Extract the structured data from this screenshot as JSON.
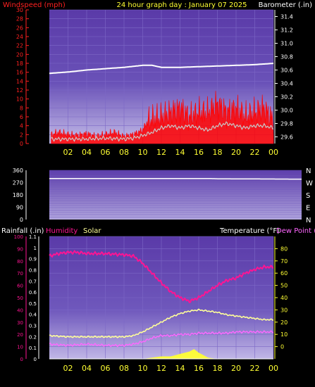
{
  "header": {
    "left_title": "Windspeed (mph)",
    "center_title": "24 hour graph day : January 07 2025",
    "right_title": "Barometer (.in)"
  },
  "mid_labels": {
    "rainfall": "Rainfall (.in)",
    "humidity": "Humidity",
    "solar": "Solar",
    "temperature": "Temperature (°F)",
    "dewpoint": "Dew Point ("
  },
  "colors": {
    "panel_top": "#5a3aa8",
    "panel_bottom": "#bdb4e6",
    "axis_red": "#ff2020",
    "axis_yellow": "#ffff33",
    "axis_white": "#ffffff",
    "wind": "#ff0000",
    "wind_avg": "#c8c8c8",
    "baro": "#ffffff",
    "humidity": "#ff1493",
    "solar": "#ffff33",
    "temperature": "#ffff99",
    "dewpoint": "#ff66ff",
    "rain": "#ffffff"
  },
  "chart_data": [
    {
      "type": "line",
      "name": "wind-barometer",
      "x_ticks": [
        "02",
        "04",
        "06",
        "08",
        "10",
        "12",
        "14",
        "16",
        "18",
        "20",
        "22",
        "00"
      ],
      "left_axis": {
        "title": "Windspeed (mph)",
        "ticks": [
          0,
          2,
          4,
          6,
          8,
          10,
          12,
          14,
          16,
          18,
          20,
          22,
          24,
          26,
          28,
          30
        ],
        "range": [
          0,
          30
        ]
      },
      "right_axis": {
        "title": "Barometer (.in)",
        "ticks": [
          29.6,
          29.8,
          30,
          30.2,
          30.4,
          30.6,
          30.8,
          31,
          31.2,
          31.4
        ],
        "range": [
          29.5,
          31.5
        ]
      },
      "series": [
        {
          "role": "wind-gust",
          "axis": "left",
          "points": [
            [
              0.2,
              2
            ],
            [
              1,
              2.5
            ],
            [
              2,
              2
            ],
            [
              3,
              1.8
            ],
            [
              4,
              2.2
            ],
            [
              5,
              1.6
            ],
            [
              6,
              2
            ],
            [
              7,
              2.5
            ],
            [
              8,
              1.5
            ],
            [
              9,
              2
            ],
            [
              10,
              3
            ],
            [
              10.5,
              5
            ],
            [
              11,
              5.5
            ],
            [
              12,
              6
            ],
            [
              13,
              7
            ],
            [
              14,
              8
            ],
            [
              15,
              6
            ],
            [
              16,
              7
            ],
            [
              17,
              7
            ],
            [
              18,
              9
            ],
            [
              19,
              7
            ],
            [
              20,
              8
            ],
            [
              21,
              6
            ],
            [
              22,
              7
            ],
            [
              23,
              8
            ],
            [
              24,
              5
            ]
          ]
        },
        {
          "role": "wind-average",
          "axis": "left",
          "points": [
            [
              0.2,
              1
            ],
            [
              2,
              1
            ],
            [
              4,
              1
            ],
            [
              6,
              1.2
            ],
            [
              8,
              1
            ],
            [
              9,
              1.2
            ],
            [
              10,
              1.8
            ],
            [
              11,
              2.5
            ],
            [
              12,
              3.5
            ],
            [
              13,
              4
            ],
            [
              14,
              3.5
            ],
            [
              15,
              4
            ],
            [
              16,
              3.5
            ],
            [
              17,
              3
            ],
            [
              18,
              4
            ],
            [
              19,
              4.5
            ],
            [
              20,
              4
            ],
            [
              21,
              3.5
            ],
            [
              22,
              4
            ],
            [
              23,
              4
            ],
            [
              24,
              3.5
            ]
          ]
        },
        {
          "role": "barometer",
          "axis": "right",
          "points": [
            [
              0,
              30.55
            ],
            [
              2,
              30.57
            ],
            [
              4,
              30.6
            ],
            [
              6,
              30.62
            ],
            [
              8,
              30.64
            ],
            [
              10,
              30.67
            ],
            [
              11,
              30.67
            ],
            [
              12,
              30.64
            ],
            [
              14,
              30.64
            ],
            [
              16,
              30.65
            ],
            [
              18,
              30.66
            ],
            [
              20,
              30.67
            ],
            [
              22,
              30.68
            ],
            [
              24,
              30.7
            ]
          ]
        }
      ]
    },
    {
      "type": "line",
      "name": "wind-direction",
      "right_labels": [
        "N",
        "W",
        "S",
        "E",
        "N"
      ],
      "left_axis": {
        "ticks": [
          0,
          90,
          180,
          270,
          360
        ],
        "range": [
          0,
          360
        ]
      },
      "series": [
        {
          "role": "direction",
          "points": [
            [
              0,
              300
            ],
            [
              15,
              300
            ],
            [
              16,
              298
            ],
            [
              24,
              295
            ]
          ]
        }
      ]
    },
    {
      "type": "line",
      "name": "rain-humidity-temperature",
      "x_ticks": [
        "02",
        "04",
        "06",
        "08",
        "10",
        "12",
        "14",
        "16",
        "18",
        "20",
        "22",
        "00"
      ],
      "left_axis": {
        "title": "Rainfall (.in)",
        "ticks": [
          0,
          10,
          20,
          30,
          40,
          50,
          60,
          70,
          80,
          90,
          100
        ],
        "range": [
          0,
          100
        ]
      },
      "left_inner_axis": {
        "ticks": [
          0,
          0.1,
          0.2,
          0.3,
          0.4,
          0.5,
          0.6,
          0.7,
          0.8,
          0.9,
          1,
          1.1
        ],
        "range": [
          0,
          1.1
        ]
      },
      "right_axis": {
        "title": "Temperature (°F)",
        "ticks": [
          0,
          10,
          20,
          30,
          40,
          50,
          60,
          70,
          80
        ],
        "range": [
          -10,
          90
        ]
      },
      "series": [
        {
          "role": "humidity",
          "axis": "percent",
          "points": [
            [
              0,
              84
            ],
            [
              1,
              86
            ],
            [
              2,
              87
            ],
            [
              3,
              87
            ],
            [
              4,
              86
            ],
            [
              6,
              86
            ],
            [
              8,
              85
            ],
            [
              9,
              84
            ],
            [
              10,
              78
            ],
            [
              11,
              70
            ],
            [
              12,
              62
            ],
            [
              13,
              55
            ],
            [
              14,
              50
            ],
            [
              15,
              47
            ],
            [
              16,
              50
            ],
            [
              17,
              55
            ],
            [
              18,
              60
            ],
            [
              19,
              64
            ],
            [
              20,
              66
            ],
            [
              21,
              70
            ],
            [
              22,
              73
            ],
            [
              23,
              75
            ],
            [
              24,
              75
            ]
          ]
        },
        {
          "role": "temperature",
          "axis": "right",
          "points": [
            [
              0,
              9
            ],
            [
              2,
              8
            ],
            [
              4,
              8
            ],
            [
              6,
              8
            ],
            [
              8,
              8
            ],
            [
              9,
              9
            ],
            [
              10,
              12
            ],
            [
              11,
              16
            ],
            [
              12,
              20
            ],
            [
              13,
              24
            ],
            [
              14,
              27
            ],
            [
              15,
              29
            ],
            [
              16,
              30
            ],
            [
              17,
              29
            ],
            [
              18,
              28
            ],
            [
              19,
              26
            ],
            [
              20,
              25
            ],
            [
              21,
              24
            ],
            [
              22,
              23
            ],
            [
              23,
              22
            ],
            [
              24,
              22
            ]
          ]
        },
        {
          "role": "dewpoint",
          "axis": "right",
          "points": [
            [
              0,
              2
            ],
            [
              2,
              1
            ],
            [
              4,
              2
            ],
            [
              6,
              1
            ],
            [
              8,
              1
            ],
            [
              9,
              2
            ],
            [
              10,
              4
            ],
            [
              11,
              7
            ],
            [
              12,
              9
            ],
            [
              13,
              9
            ],
            [
              14,
              10
            ],
            [
              15,
              10
            ],
            [
              16,
              11
            ],
            [
              17,
              11
            ],
            [
              18,
              11
            ],
            [
              19,
              11
            ],
            [
              20,
              12
            ],
            [
              21,
              12
            ],
            [
              22,
              12
            ],
            [
              23,
              12
            ],
            [
              24,
              12
            ]
          ]
        },
        {
          "role": "solar",
          "axis": "percent",
          "points": [
            [
              0,
              0
            ],
            [
              10,
              0
            ],
            [
              11,
              1
            ],
            [
              12,
              2
            ],
            [
              13,
              2
            ],
            [
              14,
              4
            ],
            [
              15,
              6
            ],
            [
              15.5,
              8
            ],
            [
              16,
              5
            ],
            [
              17,
              1
            ],
            [
              18,
              0
            ],
            [
              24,
              0
            ]
          ]
        },
        {
          "role": "rain",
          "axis": "percent",
          "points": [
            [
              0,
              0
            ],
            [
              24,
              0
            ]
          ]
        }
      ]
    }
  ]
}
